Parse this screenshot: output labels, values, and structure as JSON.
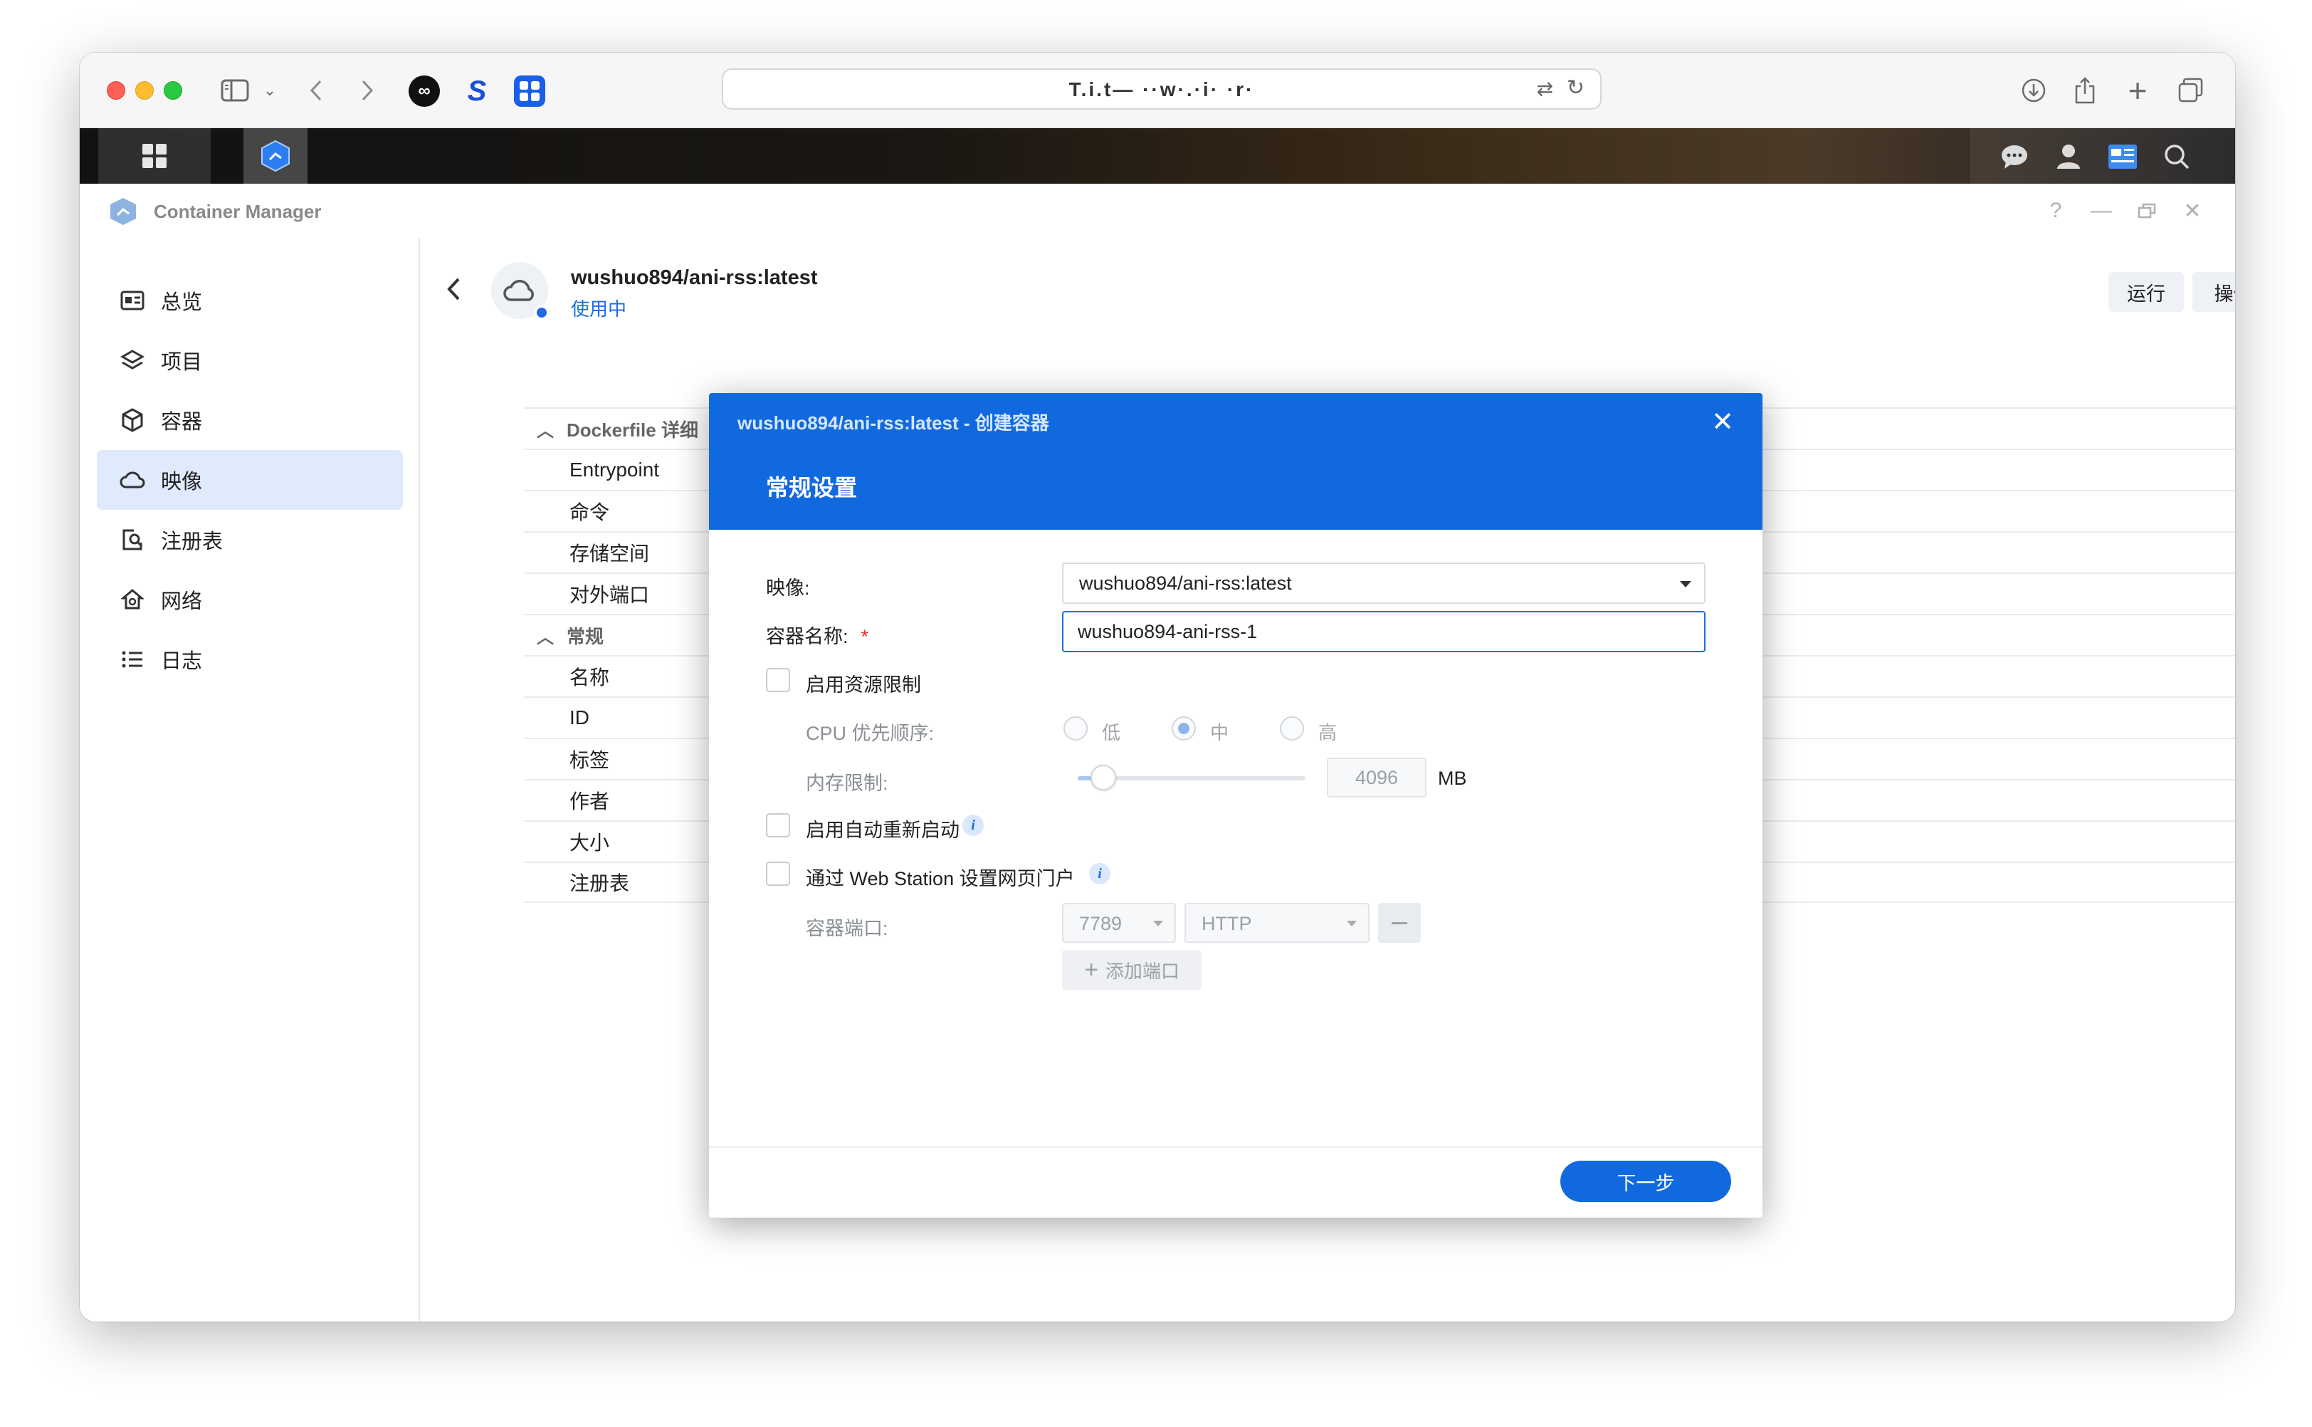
{
  "browser": {
    "url": "T.i.t— ··w·.·i· ·r·",
    "new_tab": "+"
  },
  "app": {
    "title": "Container Manager"
  },
  "sidebar": {
    "items": [
      {
        "label": "总览",
        "icon": "overview-icon"
      },
      {
        "label": "项目",
        "icon": "project-layers-icon"
      },
      {
        "label": "容器",
        "icon": "container-box-icon"
      },
      {
        "label": "映像",
        "icon": "image-cloud-icon",
        "active": true
      },
      {
        "label": "注册表",
        "icon": "registry-search-icon"
      },
      {
        "label": "网络",
        "icon": "network-house-icon"
      },
      {
        "label": "日志",
        "icon": "log-list-icon"
      }
    ]
  },
  "image": {
    "name": "wushuo894/ani-rss:latest",
    "status": "使用中",
    "run_label": "运行",
    "actions_label": "操作 ▾"
  },
  "details": {
    "sections": [
      {
        "title": "Dockerfile 详细",
        "rows": [
          "Entrypoint",
          "命令",
          "存储空间",
          "对外端口"
        ]
      },
      {
        "title": "常规",
        "rows": [
          "名称",
          "ID",
          "标签",
          "作者",
          "大小",
          "注册表"
        ]
      }
    ]
  },
  "modal": {
    "title": "wushuo894/ani-rss:latest - 创建容器",
    "section": "常规设置",
    "image_label": "映像:",
    "image_value": "wushuo894/ani-rss:latest",
    "name_label": "容器名称:",
    "name_required": "*",
    "name_value": "wushuo894-ani-rss-1",
    "resource_limit_label": "启用资源限制",
    "cpu_priority_label": "CPU 优先顺序:",
    "cpu_options": [
      "低",
      "中",
      "高"
    ],
    "cpu_selected": "中",
    "memory_label": "内存限制:",
    "memory_value": "4096",
    "memory_unit": "MB",
    "memory_slider_fraction": 0.06,
    "auto_restart_label": "启用自动重新启动",
    "web_station_label": "通过 Web Station 设置网页门户",
    "container_port_label": "容器端口:",
    "port_value": "7789",
    "protocol_value": "HTTP",
    "add_port_label": "添加端口",
    "next_label": "下一步"
  },
  "colors": {
    "accent": "#1169df",
    "active_nav": "#dfeafc",
    "required": "#e8302a"
  }
}
